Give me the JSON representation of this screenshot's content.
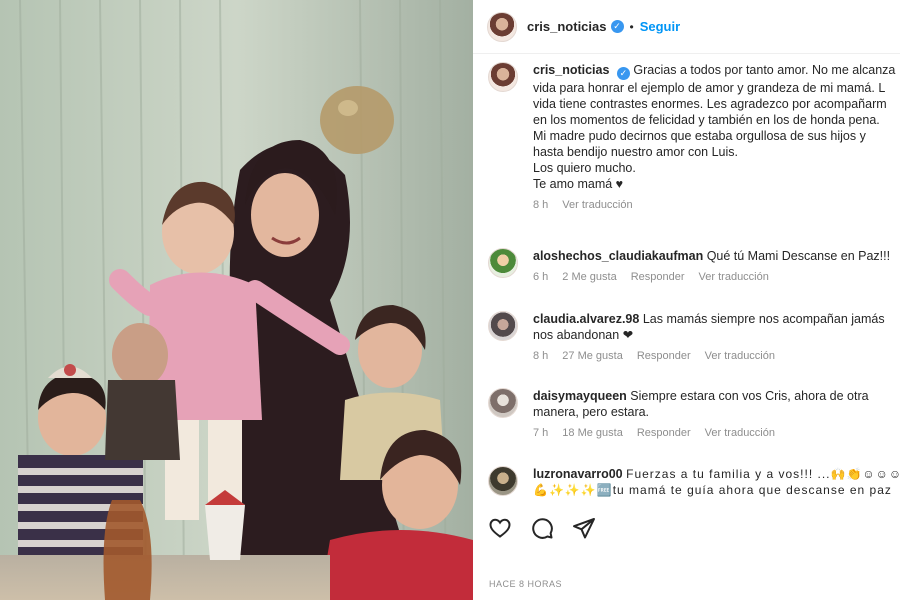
{
  "post": {
    "username": "cris_noticias",
    "follow_label": "Seguir",
    "separator": "•",
    "caption_lines": [
      "Gracias a todos por tanto amor. No me alcanza",
      "vida para honrar el ejemplo de amor y grandeza de mi mamá. L",
      "vida tiene contrastes enormes. Les agradezco por acompañarm",
      "en los momentos de felicidad y también en los de honda pena.",
      "Mi madre pudo decirnos que estaba orgullosa de sus hijos y",
      "hasta bendijo nuestro amor con Luis.",
      "Los quiero mucho.",
      "Te amo mamá ♥"
    ],
    "caption_time": "8 h",
    "caption_translate": "Ver traducción",
    "posted_ago": "HACE 8 HORAS"
  },
  "comments": [
    {
      "username": "aloshechos_claudiakaufman",
      "lines": [
        "Qué tú Mami Descanse en Paz!!!"
      ],
      "time": "6 h",
      "likes": "2 Me gusta",
      "reply": "Responder",
      "translate": "Ver traducción"
    },
    {
      "username": "claudia.alvarez.98",
      "lines": [
        "Las mamás siempre nos acompañan jamás",
        "nos abandonan ❤"
      ],
      "time": "8 h",
      "likes": "27 Me gusta",
      "reply": "Responder",
      "translate": "Ver traducción"
    },
    {
      "username": "daisymayqueen",
      "lines": [
        "Siempre estara con vos Cris, ahora de otra",
        "manera, pero estara."
      ],
      "time": "7 h",
      "likes": "18 Me gusta",
      "reply": "Responder",
      "translate": "Ver traducción"
    },
    {
      "username": "luzronavarro00",
      "lines": [
        "Fuerzas a tu familia y a vos!!! ...🙌👏☺☺☺💪",
        "💪✨✨✨🆓tu mamá te guía ahora que descanse en paz"
      ]
    }
  ],
  "icons": {
    "like": "heart-icon",
    "comment": "comment-icon",
    "share": "share-icon",
    "verified": "verified-badge-icon"
  },
  "colors": {
    "link_blue": "#0095f6",
    "verified_blue": "#3897f0",
    "muted_text": "#8e8e8e",
    "heart_red": "#e0245e"
  }
}
